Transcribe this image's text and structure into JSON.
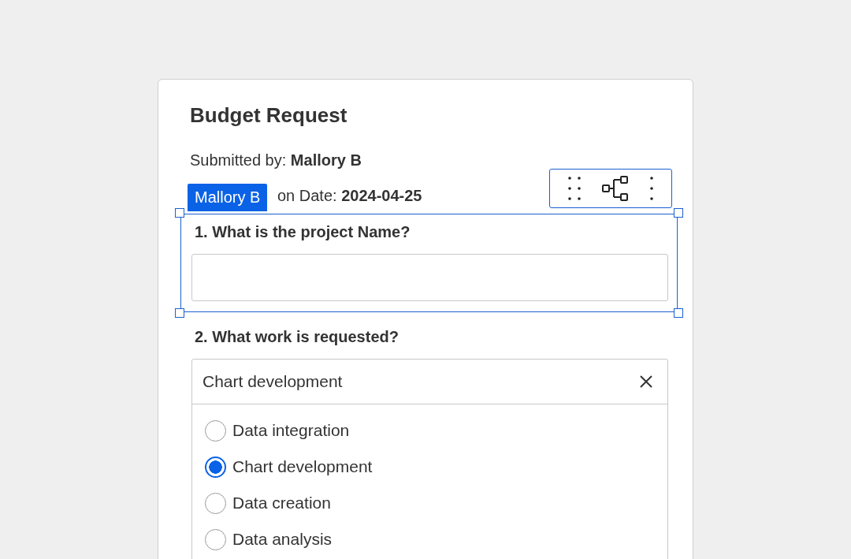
{
  "form": {
    "title": "Budget Request",
    "submitted_by": "Submitted by: **Mallory B**",
    "date_line": "on Date: **2024-04-25**"
  },
  "selection": {
    "user_tag": "Mallory B"
  },
  "questions": [
    {
      "kind": "text",
      "label": "1. What is the project Name?",
      "selected": true
    },
    {
      "kind": "choice",
      "label": "2. What work is requested?",
      "selected": false,
      "value": "Chart development",
      "options": [
        {
          "label": "Data integration",
          "selected": false
        },
        {
          "label": "Chart development",
          "selected": true
        },
        {
          "label": "Data creation",
          "selected": false
        },
        {
          "label": "Data analysis",
          "selected": false
        }
      ]
    }
  ]
}
